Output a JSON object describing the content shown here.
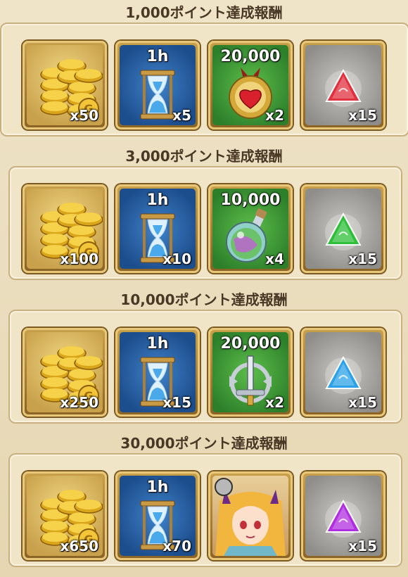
{
  "tiers": [
    {
      "title": "1,000ポイント達成報酬",
      "items": [
        {
          "icon": "gold-coins-icon",
          "top_label": "",
          "qty": "x50"
        },
        {
          "icon": "hourglass-icon",
          "top_label": "1h",
          "qty": "x5"
        },
        {
          "icon": "heart-medal-icon",
          "top_label": "20,000",
          "qty": "x2"
        },
        {
          "icon": "red-crystal-icon",
          "top_label": "",
          "qty": "x15"
        }
      ]
    },
    {
      "title": "3,000ポイント達成報酬",
      "items": [
        {
          "icon": "gold-coins-icon",
          "top_label": "",
          "qty": "x100"
        },
        {
          "icon": "hourglass-icon",
          "top_label": "1h",
          "qty": "x10"
        },
        {
          "icon": "potion-flask-icon",
          "top_label": "10,000",
          "qty": "x4"
        },
        {
          "icon": "green-crystal-icon",
          "top_label": "",
          "qty": "x15"
        }
      ]
    },
    {
      "title": "10,000ポイント達成報酬",
      "items": [
        {
          "icon": "gold-coins-icon",
          "top_label": "",
          "qty": "x250"
        },
        {
          "icon": "hourglass-icon",
          "top_label": "1h",
          "qty": "x15"
        },
        {
          "icon": "sword-emblem-icon",
          "top_label": "20,000",
          "qty": "x2"
        },
        {
          "icon": "blue-crystal-icon",
          "top_label": "",
          "qty": "x15"
        }
      ]
    },
    {
      "title": "30,000ポイント達成報酬",
      "items": [
        {
          "icon": "gold-coins-icon",
          "top_label": "",
          "qty": "x650"
        },
        {
          "icon": "hourglass-icon",
          "top_label": "1h",
          "qty": "x70"
        },
        {
          "icon": "character-portrait-icon",
          "top_label": "",
          "qty": ""
        },
        {
          "icon": "purple-crystal-icon",
          "top_label": "",
          "qty": "x15"
        }
      ]
    }
  ]
}
